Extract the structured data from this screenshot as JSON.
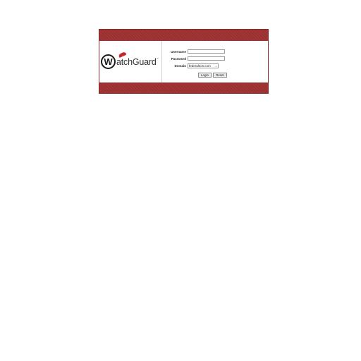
{
  "logo": {
    "letter": "W",
    "text": "atchGuard",
    "tm": "™",
    "accent_color": "#c62a2a"
  },
  "form": {
    "username_label": "Username",
    "password_label": "Password",
    "domain_label": "Domain",
    "username_value": "",
    "password_value": "",
    "domain_selected": "federaleos.com",
    "login_label": "Login",
    "reset_label": "Reset"
  },
  "theme": {
    "band_color": "#9c2f2f"
  }
}
